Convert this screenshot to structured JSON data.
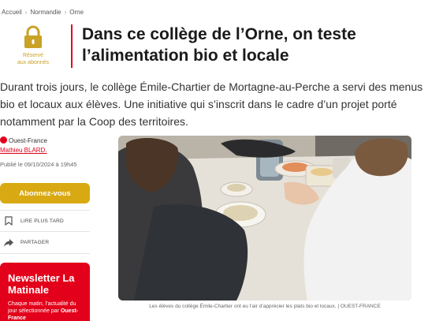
{
  "breadcrumb": [
    "Accueil",
    "Normandie",
    "Orne"
  ],
  "premium": {
    "label_line1": "Réservé",
    "label_line2": "aux abonnés",
    "icon": "lock-icon",
    "color": "#c9a227"
  },
  "article": {
    "headline": "Dans ce collège de l’Orne, on teste l’alimentation bio et locale",
    "lede": "Durant trois jours, le collège Émile-Chartier de Mortagne-au-Perche a servi des menus bio et locaux aux élèves. Une initiative qui s’inscrit dans le cadre d’un projet porté notamment par la Coop des territoires.",
    "source": "Ouest-France",
    "author": "Mathieu BLARD",
    "published": "Publié le 09/10/2024 à 19h45",
    "image_caption": "Les élèves du collège Émile-Chartier ont eu l’air d’apprécier les plats bio et locaux. | OUEST-FRANCE"
  },
  "sidebar": {
    "subscribe_label": "Abonnez-vous",
    "read_later_label": "LIRE PLUS TARD",
    "share_label": "PARTAGER",
    "newsletter_title": "Newsletter La Matinale",
    "newsletter_desc": "Chaque matin, l’actualité du jour sélectionnée par",
    "newsletter_brand": "Ouest-France"
  },
  "colors": {
    "accent": "#e2001a",
    "gold": "#d8a912"
  }
}
